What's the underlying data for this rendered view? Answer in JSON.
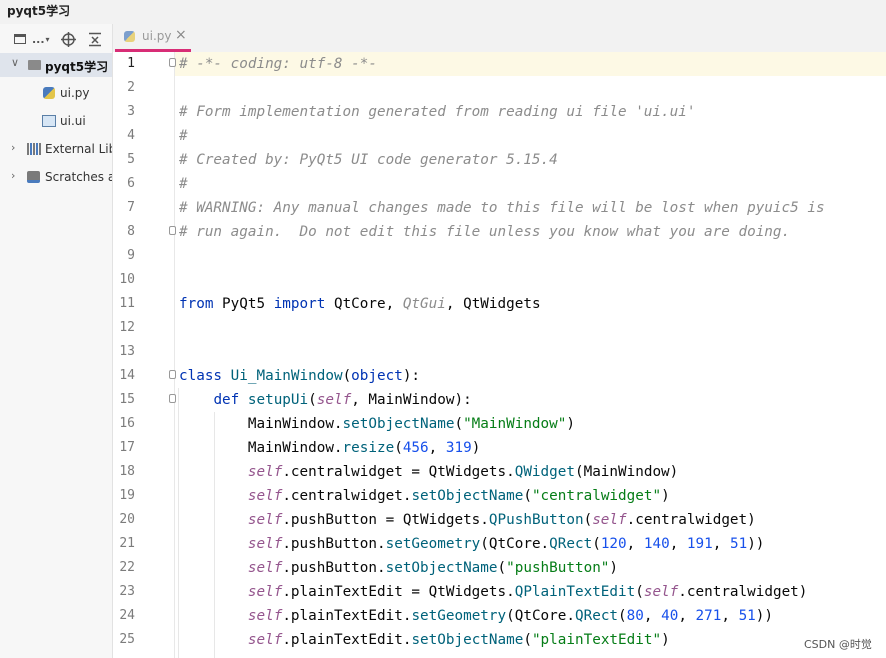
{
  "window": {
    "title": "pyqt5学习"
  },
  "project_panel": {
    "toolbar": {
      "view_label": "..."
    },
    "tree": [
      {
        "label": "pyqt5学习",
        "kind": "folder",
        "expanded": true
      },
      {
        "label": "ui.py",
        "kind": "python-file"
      },
      {
        "label": "ui.ui",
        "kind": "ui-file"
      },
      {
        "label": "External Lib",
        "kind": "library"
      },
      {
        "label": "Scratches a",
        "kind": "scratches"
      }
    ]
  },
  "tabs": [
    {
      "label": "ui.py",
      "active": true
    }
  ],
  "editor": {
    "current_line": 1,
    "lines": [
      {
        "n": "1",
        "text": "# -*- coding: utf-8 -*-"
      },
      {
        "n": "2",
        "text": ""
      },
      {
        "n": "3",
        "text": "# Form implementation generated from reading ui file 'ui.ui'"
      },
      {
        "n": "4",
        "text": "#"
      },
      {
        "n": "5",
        "text": "# Created by: PyQt5 UI code generator 5.15.4"
      },
      {
        "n": "6",
        "text": "#"
      },
      {
        "n": "7",
        "text": "# WARNING: Any manual changes made to this file will be lost when pyuic5 is"
      },
      {
        "n": "8",
        "text": "# run again.  Do not edit this file unless you know what you are doing."
      },
      {
        "n": "9",
        "text": ""
      },
      {
        "n": "10",
        "text": ""
      },
      {
        "n": "11",
        "text": "from PyQt5 import QtCore, QtGui, QtWidgets"
      },
      {
        "n": "12",
        "text": ""
      },
      {
        "n": "13",
        "text": ""
      },
      {
        "n": "14",
        "text": "class Ui_MainWindow(object):"
      },
      {
        "n": "15",
        "text": "    def setupUi(self, MainWindow):"
      },
      {
        "n": "16",
        "text": "        MainWindow.setObjectName(\"MainWindow\")"
      },
      {
        "n": "17",
        "text": "        MainWindow.resize(456, 319)"
      },
      {
        "n": "18",
        "text": "        self.centralwidget = QtWidgets.QWidget(MainWindow)"
      },
      {
        "n": "19",
        "text": "        self.centralwidget.setObjectName(\"centralwidget\")"
      },
      {
        "n": "20",
        "text": "        self.pushButton = QtWidgets.QPushButton(self.centralwidget)"
      },
      {
        "n": "21",
        "text": "        self.pushButton.setGeometry(QtCore.QRect(120, 140, 191, 51))"
      },
      {
        "n": "22",
        "text": "        self.pushButton.setObjectName(\"pushButton\")"
      },
      {
        "n": "23",
        "text": "        self.plainTextEdit = QtWidgets.QPlainTextEdit(self.centralwidget)"
      },
      {
        "n": "24",
        "text": "        self.plainTextEdit.setGeometry(QtCore.QRect(80, 40, 271, 51))"
      },
      {
        "n": "25",
        "text": "        self.plainTextEdit.setObjectName(\"plainTextEdit\")"
      }
    ]
  },
  "watermark": "CSDN @时觉",
  "colors": {
    "comment": "#8c8c8c",
    "keyword": "#0033b3",
    "function": "#00627a",
    "string": "#067d17",
    "number": "#1750eb",
    "self": "#94558d",
    "current_line_bg": "#fdf9e5",
    "tab_underline": "#d82d76",
    "selection_bg": "#dfe4ec"
  }
}
